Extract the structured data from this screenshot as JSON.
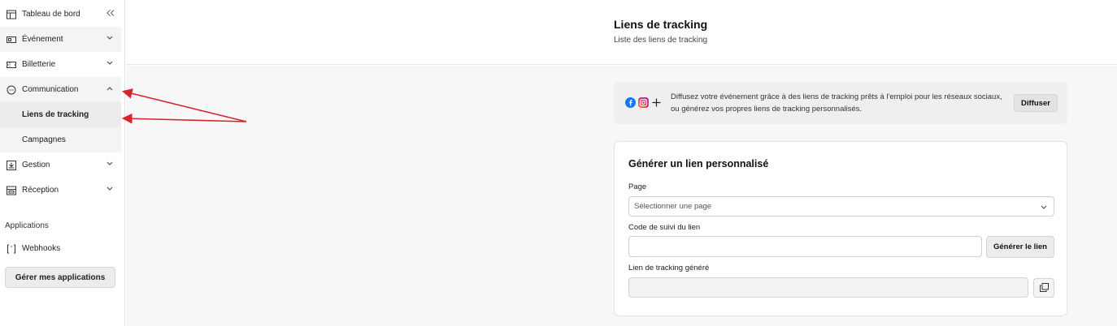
{
  "sidebar": {
    "items": [
      {
        "label": "Tableau de bord",
        "icon": "layout-icon"
      },
      {
        "label": "Événement",
        "icon": "ticket-icon"
      },
      {
        "label": "Billetterie",
        "icon": "ticket-stub-icon"
      },
      {
        "label": "Communication",
        "icon": "chat-bubble-icon"
      },
      {
        "label": "Gestion",
        "icon": "download-box-icon"
      },
      {
        "label": "Réception",
        "icon": "store-icon"
      }
    ],
    "sub_items": [
      {
        "label": "Liens de tracking"
      },
      {
        "label": "Campagnes"
      }
    ],
    "applications_label": "Applications",
    "webhooks_label": "Webhooks",
    "manage_apps_label": "Gérer mes applications"
  },
  "header": {
    "title": "Liens de tracking",
    "subtitle": "Liste des liens de tracking"
  },
  "banner": {
    "text": "Diffusez votre événement grâce à des liens de tracking prêts à l'emploi pour les réseaux sociaux, ou générez vos propres liens de tracking personnalisés.",
    "button_label": "Diffuser"
  },
  "form": {
    "title": "Générer un lien personnalisé",
    "page_label": "Page",
    "page_placeholder": "Sélectionner une page",
    "code_label": "Code de suivi du lien",
    "code_value": "",
    "generate_label": "Générer le lien",
    "generated_label": "Lien de tracking généré",
    "generated_value": ""
  },
  "colors": {
    "annotation_arrow": "#d6262a",
    "facebook": "#1877f2",
    "instagram": "#c13584"
  }
}
